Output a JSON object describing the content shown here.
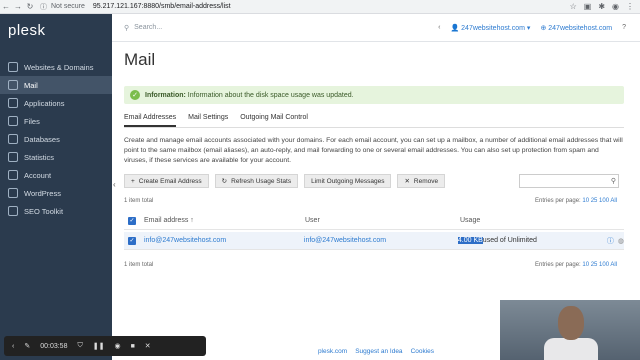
{
  "browser": {
    "security_label": "Not secure",
    "url": "95.217.121.167:8880/smb/email-address/list"
  },
  "sidebar": {
    "logo": "plesk",
    "items": [
      {
        "label": "Websites & Domains",
        "icon": "globe-icon"
      },
      {
        "label": "Mail",
        "icon": "mail-icon"
      },
      {
        "label": "Applications",
        "icon": "apps-icon"
      },
      {
        "label": "Files",
        "icon": "folder-icon"
      },
      {
        "label": "Databases",
        "icon": "database-icon"
      },
      {
        "label": "Statistics",
        "icon": "chart-icon"
      },
      {
        "label": "Account",
        "icon": "user-icon"
      },
      {
        "label": "WordPress",
        "icon": "wordpress-icon"
      },
      {
        "label": "SEO Toolkit",
        "icon": "seo-icon"
      }
    ]
  },
  "topbar": {
    "search_placeholder": "Search...",
    "user": "247websitehost.com",
    "subscription": "247websitehost.com"
  },
  "page": {
    "title": "Mail",
    "info_bold": "Information:",
    "info_text": "Information about the disk space usage was updated.",
    "tabs": [
      "Email Addresses",
      "Mail Settings",
      "Outgoing Mail Control"
    ],
    "description": "Create and manage email accounts associated with your domains. For each email account, you can set up a mailbox, a number of additional email addresses that will point to the same mailbox (email aliases), an auto-reply, and mail forwarding to one or several email addresses. You can also set up protection from spam and viruses, if these services are available for your account.",
    "buttons": {
      "create": "Create Email Address",
      "refresh": "Refresh Usage Stats",
      "limit": "Limit Outgoing Messages",
      "remove": "Remove"
    },
    "item_count": "1 item total",
    "entries_label": "Entries per page:",
    "entries_options": "10 25 100 All",
    "columns": {
      "email": "Email address ↑",
      "user": "User",
      "usage": "Usage"
    },
    "row": {
      "email": "info@247websitehost.com",
      "user": "info@247websitehost.com",
      "usage_value": "4.00 KB",
      "usage_rest": "used of Unlimited"
    }
  },
  "footer": {
    "links": [
      "plesk.com",
      "Suggest an Idea",
      "Cookies"
    ]
  },
  "recorder": {
    "time": "00:03:58"
  }
}
